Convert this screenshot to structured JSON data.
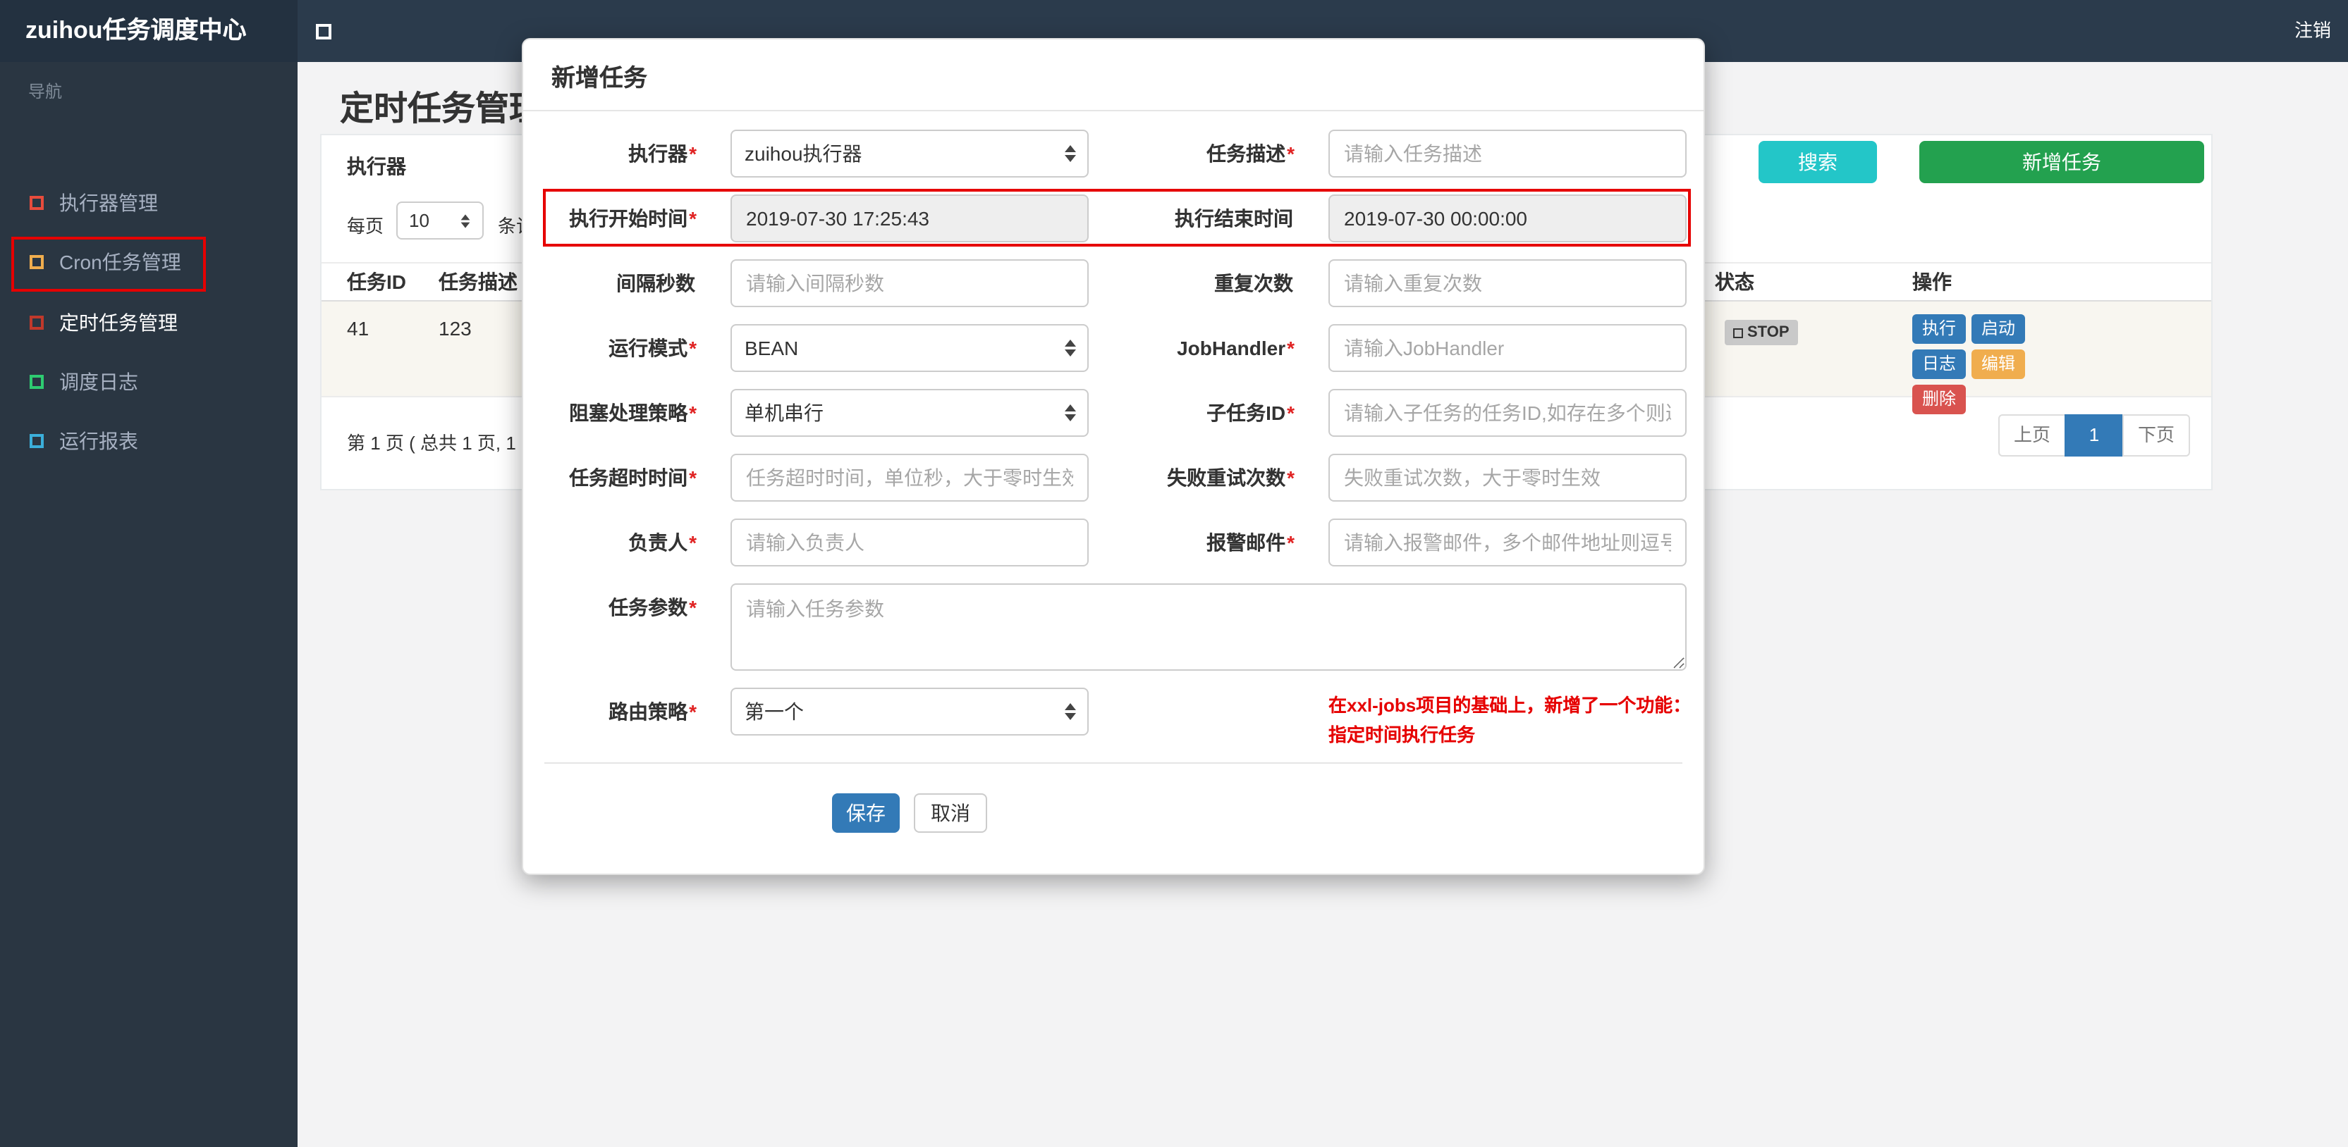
{
  "colors": {
    "accent_red": "#e60000",
    "search_btn": "#23c6c8",
    "add_btn": "#23a14f",
    "primary_btn": "#337ab7",
    "warn_btn": "#f0ad4e",
    "danger_btn": "#d9534f",
    "status_stop_bg": "#c9c9c9"
  },
  "navbar": {
    "brand": "zuihou任务调度中心",
    "logout": "注销"
  },
  "sidebar": {
    "header": "导航",
    "items": [
      {
        "label": "执行器管理",
        "icon_color": "#e74c3c"
      },
      {
        "label": "Cron任务管理",
        "icon_color": "#f0ad4e"
      },
      {
        "label": "定时任务管理",
        "icon_color": "#c0392b"
      },
      {
        "label": "调度日志",
        "icon_color": "#2ecc71"
      },
      {
        "label": "运行报表",
        "icon_color": "#3bafda"
      }
    ]
  },
  "page": {
    "title": "定时任务管理",
    "filter_label": "执行器",
    "search": "搜索",
    "add": "新增任务",
    "per_page_label": "每页",
    "per_page_value": "10",
    "per_page_suffix": "条记"
  },
  "table": {
    "headers": {
      "id": "任务ID",
      "desc": "任务描述",
      "status": "状态",
      "actions": "操作"
    },
    "row": {
      "id": "41",
      "desc": "123",
      "status": "STOP",
      "btn_run": "执行",
      "btn_start": "启动",
      "btn_log": "日志",
      "btn_edit": "编辑",
      "btn_delete": "删除"
    },
    "summary": "第 1 页 ( 总共 1 页, 1",
    "prev": "上页",
    "current": "1",
    "next": "下页"
  },
  "modal": {
    "title": "新增任务",
    "rows": [
      {
        "left": {
          "label": "执行器",
          "star": "*",
          "value": "zuihou执行器"
        },
        "right": {
          "label": "任务描述",
          "star": "*",
          "placeholder": "请输入任务描述"
        }
      },
      {
        "left": {
          "label": "执行开始时间",
          "star": "*",
          "value": "2019-07-30 17:25:43"
        },
        "right": {
          "label": "执行结束时间",
          "star": "",
          "value": "2019-07-30 00:00:00"
        }
      },
      {
        "left": {
          "label": "间隔秒数",
          "star": "",
          "placeholder": "请输入间隔秒数"
        },
        "right": {
          "label": "重复次数",
          "star": "",
          "placeholder": "请输入重复次数"
        }
      },
      {
        "left": {
          "label": "运行模式",
          "star": "*",
          "value": "BEAN"
        },
        "right": {
          "label": "JobHandler",
          "star": "*",
          "placeholder": "请输入JobHandler"
        }
      },
      {
        "left": {
          "label": "阻塞处理策略",
          "star": "*",
          "value": "单机串行"
        },
        "right": {
          "label": "子任务ID",
          "star": "*",
          "placeholder": "请输入子任务的任务ID,如存在多个则逗号分隔"
        }
      },
      {
        "left": {
          "label": "任务超时时间",
          "star": "*",
          "placeholder": "任务超时时间，单位秒，大于零时生效"
        },
        "right": {
          "label": "失败重试次数",
          "star": "*",
          "placeholder": "失败重试次数，大于零时生效"
        }
      },
      {
        "left": {
          "label": "负责人",
          "star": "*",
          "placeholder": "请输入负责人"
        },
        "right": {
          "label": "报警邮件",
          "star": "*",
          "placeholder": "请输入报警邮件，多个邮件地址则逗号分隔"
        }
      }
    ],
    "params": {
      "label": "任务参数",
      "star": "*",
      "placeholder": "请输入任务参数"
    },
    "route": {
      "label": "路由策略",
      "star": "*",
      "value": "第一个"
    },
    "note_line1": "在xxl-jobs项目的基础上，新增了一个功能：",
    "note_line2": "指定时间执行任务",
    "save": "保存",
    "cancel": "取消"
  }
}
